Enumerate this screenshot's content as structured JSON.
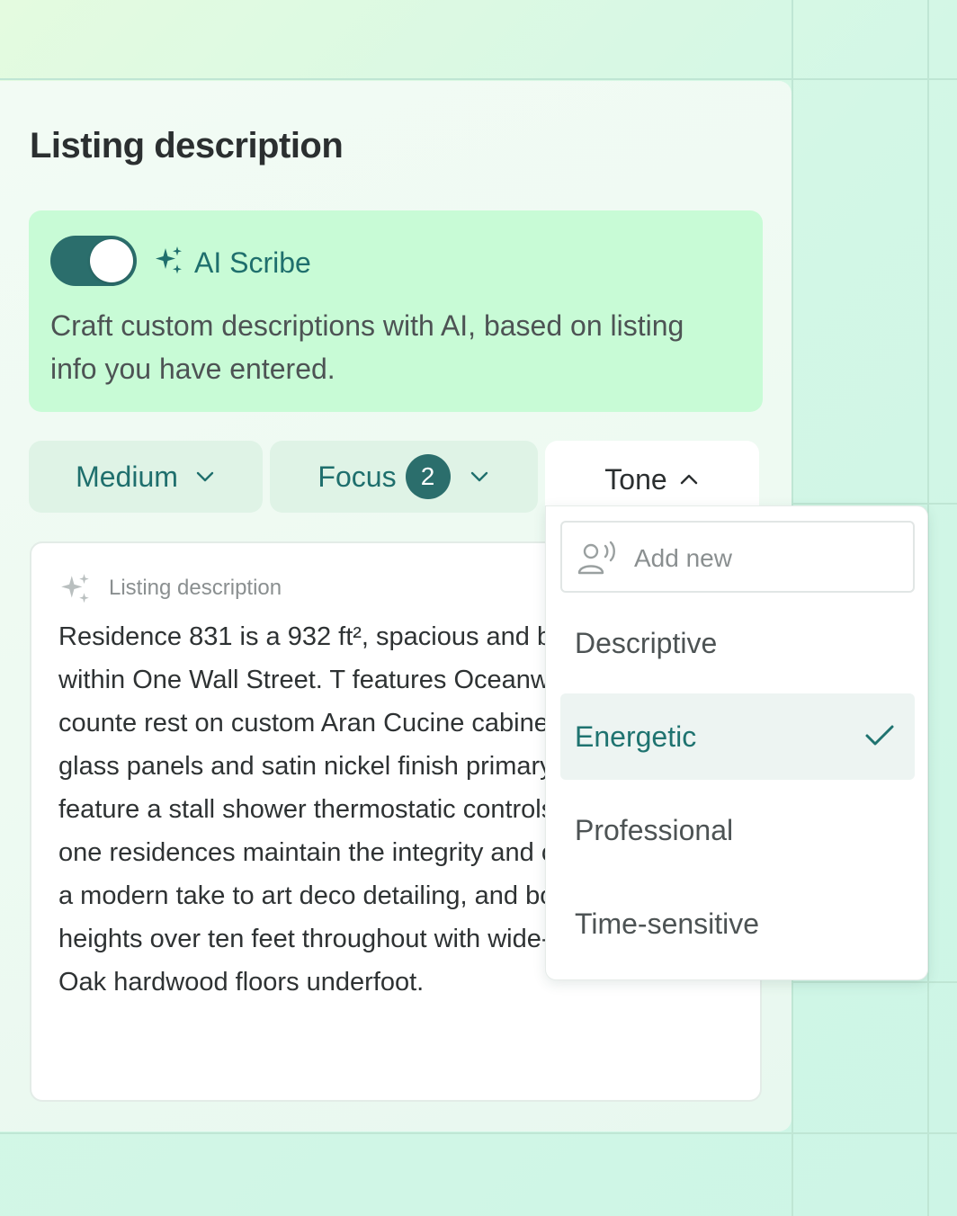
{
  "card": {
    "title": "Listing description"
  },
  "scribe": {
    "toggle_on": true,
    "label": "AI Scribe",
    "description": "Craft custom descriptions with AI, based on listing info you have entered."
  },
  "filters": {
    "medium_label": "Medium",
    "focus_label": "Focus",
    "focus_count": "2",
    "tone_label": "Tone"
  },
  "description": {
    "label": "Listing description",
    "text": "Residence 831 is a 932 ft², spacious and bedroom layout within One Wall Street. T features Oceanwood marble slab counte rest on custom Aran Cucine cabinetry, ac white glass panels and satin nickel finish primary bathrooms feature a stall shower thermostatic controls. The building’s one residences maintain the integrity and cha 1930s scale, a modern take to art deco detailing, and boast ceiling heights over ten feet throughout with wide-plank French Oak hardwood floors underfoot."
  },
  "tone_dropdown": {
    "add_new_label": "Add new",
    "options": [
      "Descriptive",
      "Energetic",
      "Professional",
      "Time-sensitive"
    ],
    "selected": "Energetic"
  },
  "colors": {
    "accent": "#1f6f6d",
    "toggle": "#2b6e6c",
    "scribe_bg": "#c8fbd6"
  },
  "icons": {
    "sparkle": "sparkle-icon",
    "chevron_down": "chevron-down-icon",
    "chevron_up": "chevron-up-icon",
    "person_voice": "person-voice-icon",
    "check": "check-icon"
  }
}
